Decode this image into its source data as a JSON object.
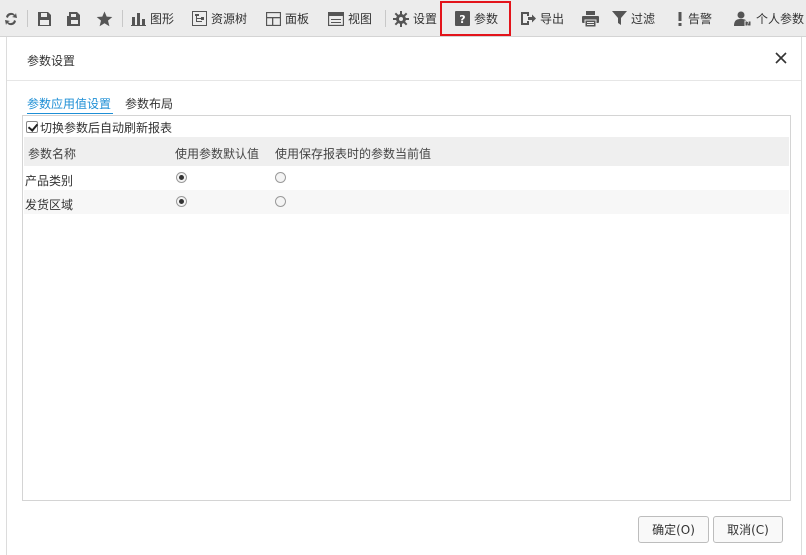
{
  "toolbar": {
    "refresh_icon": "refresh-icon",
    "save_icon": "save-icon",
    "save_as_icon": "save-as-icon",
    "favorite_icon": "star-icon",
    "chart_label": "图形",
    "resource_tree_label": "资源树",
    "panel_label": "面板",
    "view_label": "视图",
    "settings_label": "设置",
    "params_label": "参数",
    "export_label": "导出",
    "filter_label": "过滤",
    "alert_label": "告警",
    "personal_label": "个人参数"
  },
  "dialog": {
    "title": "参数设置",
    "tabs": [
      {
        "label": "参数应用值设置",
        "active": true
      },
      {
        "label": "参数布局",
        "active": false
      }
    ],
    "auto_refresh": {
      "label": "切换参数后自动刷新报表",
      "checked": true
    },
    "table": {
      "headers": [
        "参数名称",
        "使用参数默认值",
        "使用保存报表时的参数当前值"
      ],
      "rows": [
        {
          "name": "产品类别",
          "use_default": true,
          "use_saved": false
        },
        {
          "name": "发货区域",
          "use_default": true,
          "use_saved": false
        }
      ]
    },
    "buttons": {
      "ok": "确定(O)",
      "cancel": "取消(C)"
    }
  },
  "colors": {
    "accent": "#1e8fd6",
    "highlight_border": "#e3141b",
    "toolbar_bg": "#ececec"
  }
}
